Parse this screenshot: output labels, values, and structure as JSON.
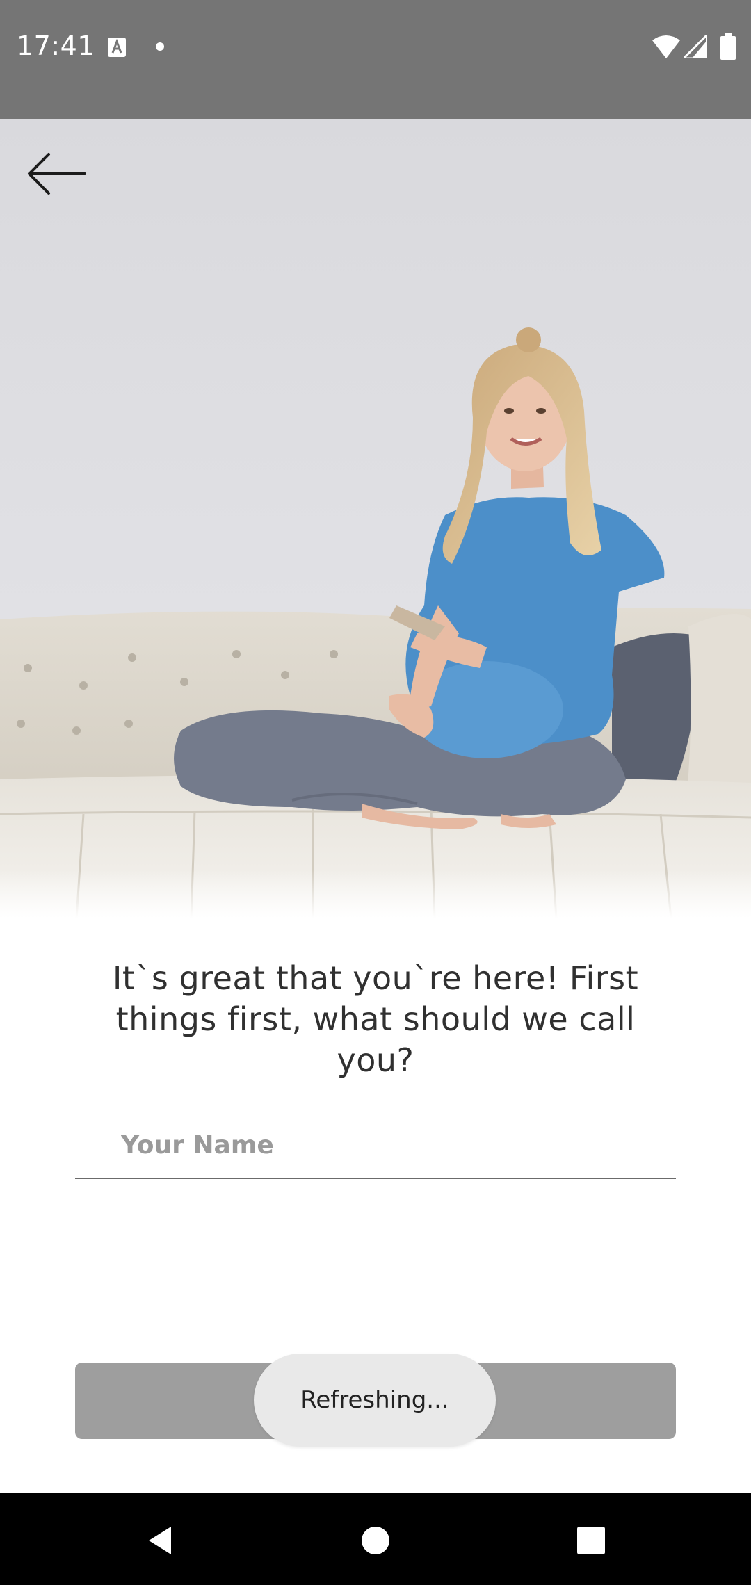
{
  "status_bar": {
    "time": "17:41",
    "icons": [
      "text-a-icon",
      "notification-dot-icon",
      "wifi-icon",
      "cell-signal-icon",
      "battery-icon"
    ]
  },
  "hero": {
    "image": "pregnant-woman-on-sofa-with-phone",
    "back_icon": "arrow-left-icon"
  },
  "onboarding": {
    "question": "It`s great that you`re here! First things first, what should we call you?",
    "name_placeholder": "Your Name",
    "name_value": ""
  },
  "continue_button": {
    "color": "#9e9e9e",
    "enabled": false
  },
  "toast": {
    "text": "Refreshing..."
  },
  "nav_bar": {
    "back_icon": "triangle-back-icon",
    "home_icon": "circle-home-icon",
    "recents_icon": "square-recents-icon"
  }
}
